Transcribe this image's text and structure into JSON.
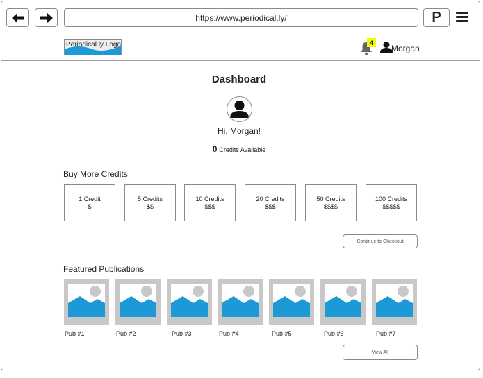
{
  "browser": {
    "back_icon": "arrow-left-icon",
    "forward_icon": "arrow-right-icon",
    "url": "https://www.periodical.ly/",
    "extension_label": "P",
    "menu_icon": "hamburger-menu-icon"
  },
  "header": {
    "logo_text": "Periodical.ly Logo",
    "notification_count": "4",
    "username": "Morgan"
  },
  "dashboard": {
    "title": "Dashboard",
    "greeting": "Hi, Morgan!",
    "credits_count": "0",
    "credits_label": "Credits Available"
  },
  "buy_credits": {
    "heading": "Buy More Credits",
    "options": [
      {
        "label": "1 Credit",
        "price": "$"
      },
      {
        "label": "5 Credits",
        "price": "$$"
      },
      {
        "label": "10 Credits",
        "price": "$$$"
      },
      {
        "label": "20 Credits",
        "price": "$$$"
      },
      {
        "label": "50 Credits",
        "price": "$$$$"
      },
      {
        "label": "100 Credits",
        "price": "$$$$$"
      }
    ],
    "checkout_label": "Continue to Checkout"
  },
  "featured": {
    "heading": "Featured Publications",
    "items": [
      "Pub #1",
      "Pub #2",
      "Pub #3",
      "Pub #4",
      "Pub #5",
      "Pub #6",
      "Pub #7"
    ],
    "view_all_label": "View All"
  },
  "colors": {
    "image_blue": "#1d9ad6",
    "image_bg": "#c8c8c8",
    "badge": "#f2ff00"
  }
}
